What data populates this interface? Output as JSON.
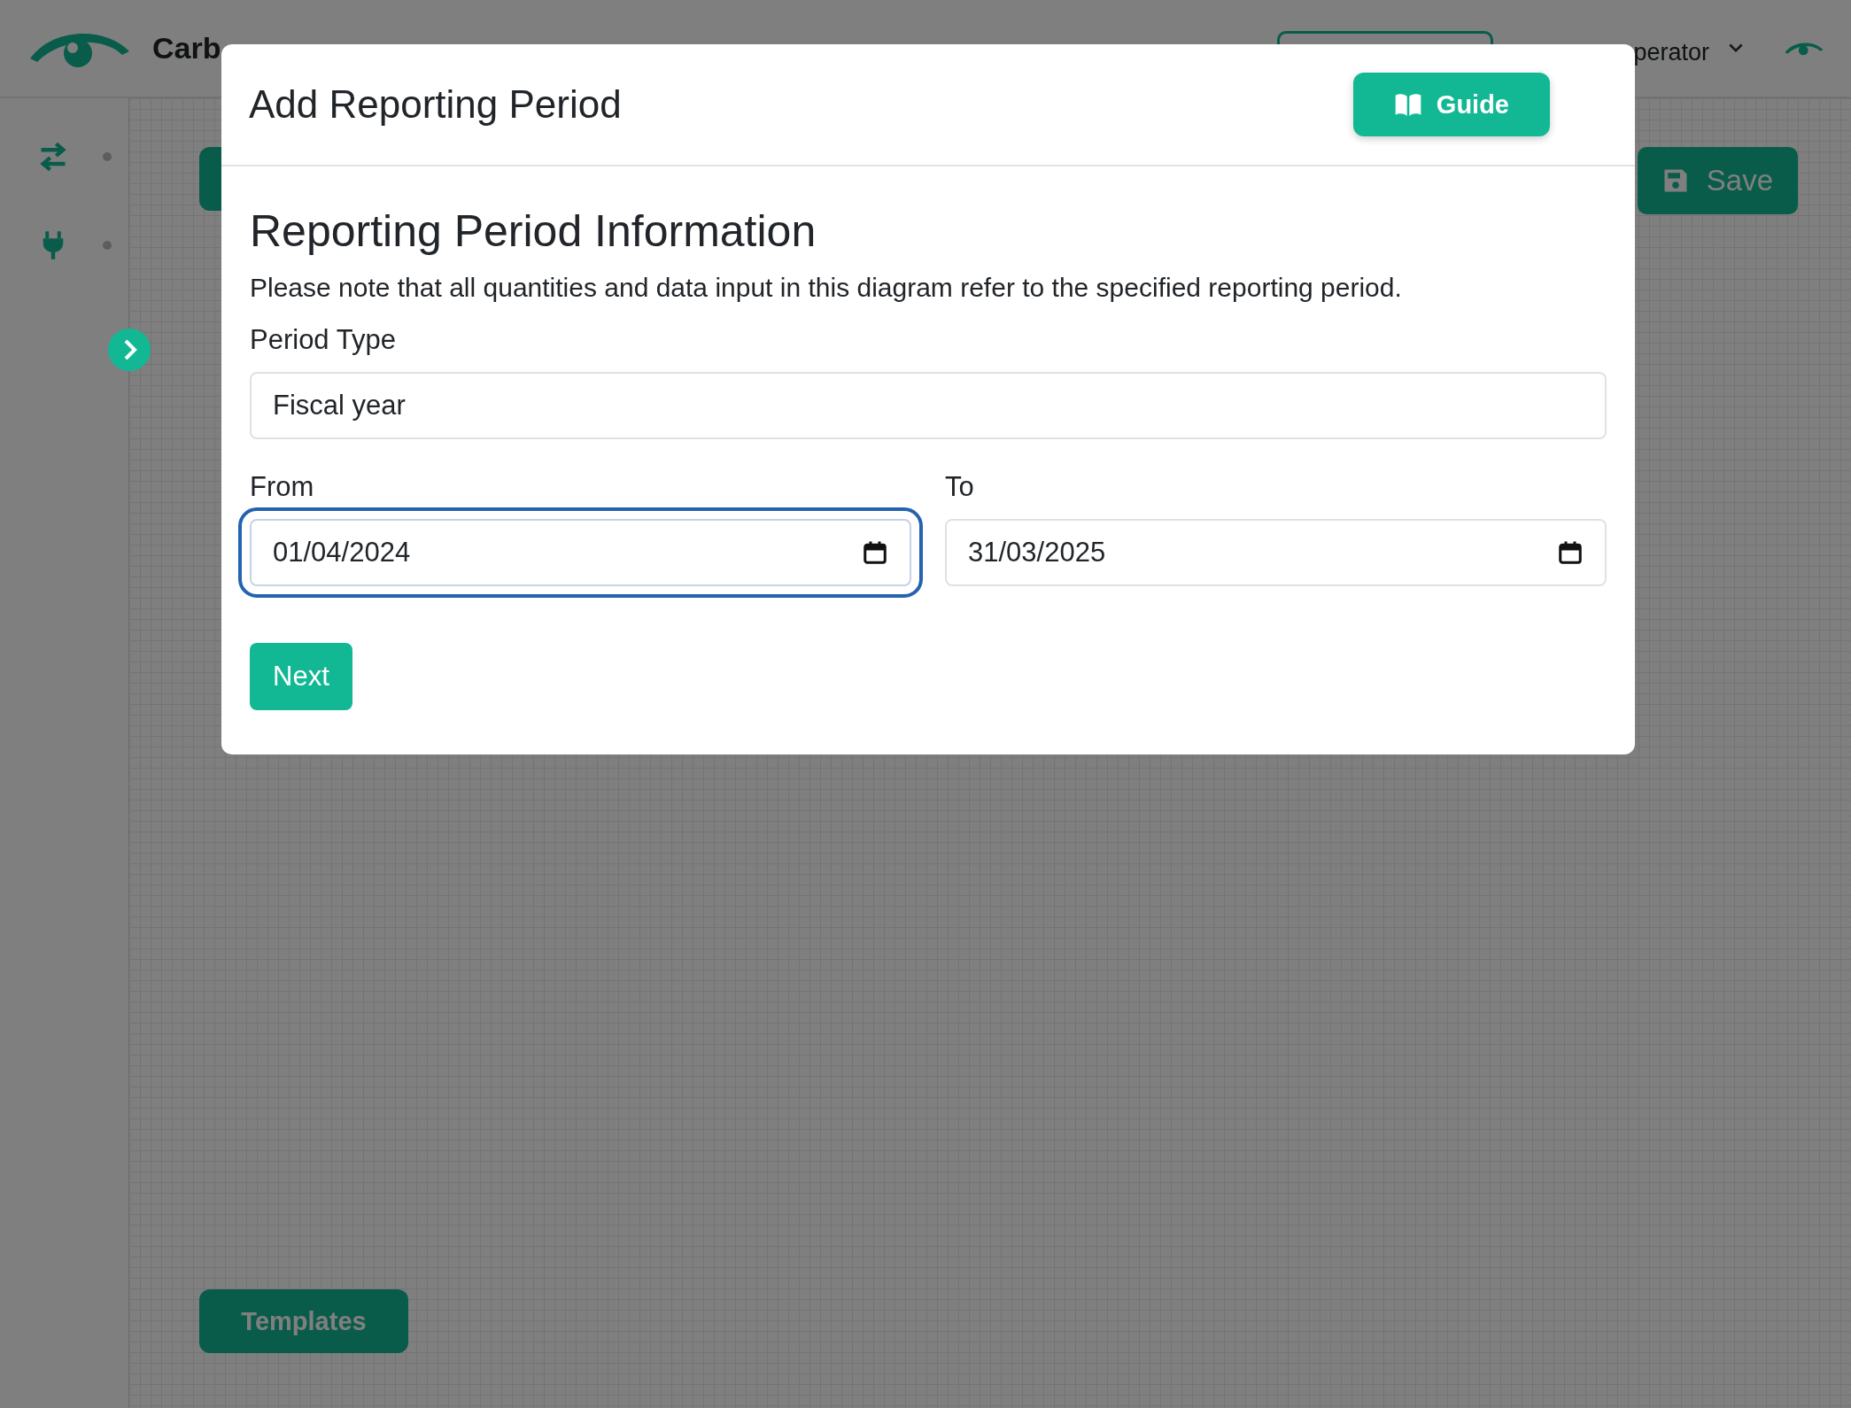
{
  "header": {
    "app_name": "Carb",
    "user_name": "perator"
  },
  "canvas": {
    "save_button": "Save",
    "templates_button": "Templates"
  },
  "modal": {
    "title": "Add Reporting Period",
    "guide_button": "Guide",
    "section_title": "Reporting Period Information",
    "note": "Please note that all quantities and data input in this diagram refer to the specified reporting period.",
    "period_type": {
      "label": "Period Type",
      "value": "Fiscal year"
    },
    "from": {
      "label": "From",
      "value": "01/04/2024",
      "focused": true
    },
    "to": {
      "label": "To",
      "value": "31/03/2025",
      "focused": false
    },
    "next_button": "Next"
  }
}
